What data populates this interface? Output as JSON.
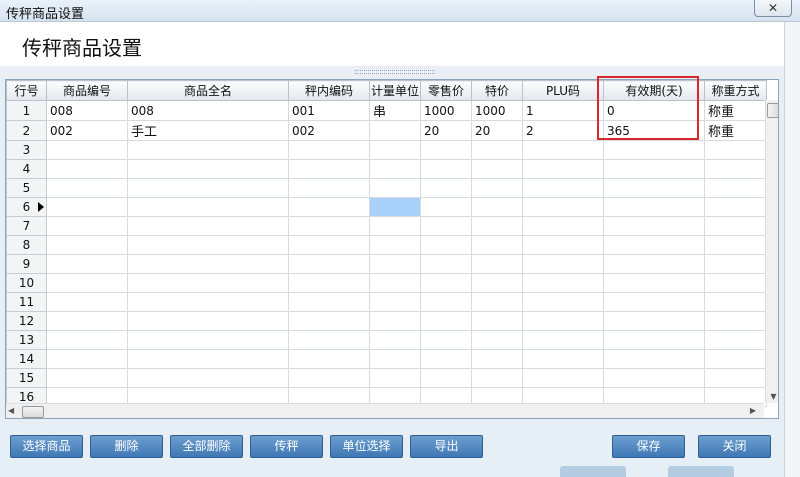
{
  "window": {
    "title": "传秤商品设置",
    "close_label": "✕"
  },
  "header": {
    "heading": "传秤商品设置"
  },
  "grid": {
    "columns": [
      "行号",
      "商品编号",
      "商品全名",
      "秤内编码",
      "计量单位",
      "零售价",
      "特价",
      "PLU码",
      "有效期(天)",
      "称重方式"
    ],
    "rows": [
      [
        "1",
        "008",
        "008",
        "001",
        "串",
        "1000",
        "1000",
        "1",
        "0",
        "称重"
      ],
      [
        "2",
        "002",
        "手工",
        "002",
        "",
        "20",
        "20",
        "2",
        "365",
        "称重"
      ],
      [
        "3",
        "",
        "",
        "",
        "",
        "",
        "",
        "",
        "",
        ""
      ],
      [
        "4",
        "",
        "",
        "",
        "",
        "",
        "",
        "",
        "",
        ""
      ],
      [
        "5",
        "",
        "",
        "",
        "",
        "",
        "",
        "",
        "",
        ""
      ],
      [
        "6",
        "",
        "",
        "",
        "",
        "",
        "",
        "",
        "",
        ""
      ],
      [
        "7",
        "",
        "",
        "",
        "",
        "",
        "",
        "",
        "",
        ""
      ],
      [
        "8",
        "",
        "",
        "",
        "",
        "",
        "",
        "",
        "",
        ""
      ],
      [
        "9",
        "",
        "",
        "",
        "",
        "",
        "",
        "",
        "",
        ""
      ],
      [
        "10",
        "",
        "",
        "",
        "",
        "",
        "",
        "",
        "",
        ""
      ],
      [
        "11",
        "",
        "",
        "",
        "",
        "",
        "",
        "",
        "",
        ""
      ],
      [
        "12",
        "",
        "",
        "",
        "",
        "",
        "",
        "",
        "",
        ""
      ],
      [
        "13",
        "",
        "",
        "",
        "",
        "",
        "",
        "",
        "",
        ""
      ],
      [
        "14",
        "",
        "",
        "",
        "",
        "",
        "",
        "",
        "",
        ""
      ],
      [
        "15",
        "",
        "",
        "",
        "",
        "",
        "",
        "",
        "",
        ""
      ],
      [
        "16",
        "",
        "",
        "",
        "",
        "",
        "",
        "",
        "",
        ""
      ]
    ],
    "current_row": "6",
    "highlight_color": "#d9272e",
    "selected_cell_color": "#a8d0f8"
  },
  "buttons": {
    "select": "选择商品",
    "delete": "删除",
    "delete_all": "全部删除",
    "send": "传秤",
    "unit_select": "单位选择",
    "export": "导出",
    "save": "保存",
    "close": "关闭"
  },
  "colors": {
    "button": "#4f86c0",
    "titlebar": "#dbe6f1"
  }
}
